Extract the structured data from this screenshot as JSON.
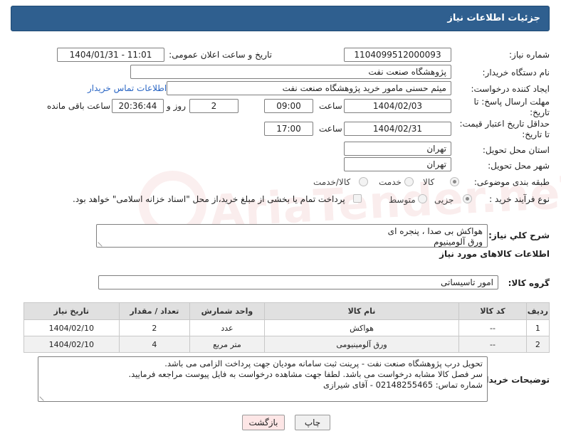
{
  "header": {
    "title": "جزئیات اطلاعات نیاز"
  },
  "form": {
    "need_number": {
      "label": "شماره نیاز:",
      "value": "1104099512000093"
    },
    "announce_datetime": {
      "label": "تاریخ و ساعت اعلان عمومی:",
      "value": "1404/01/31 - 11:01"
    },
    "buyer_org": {
      "label": "نام دستگاه خریدار:",
      "value": "پژوهشگاه صنعت نفت"
    },
    "requester": {
      "label": "ایجاد کننده درخواست:",
      "value": "میثم حسنی مامور خرید پژوهشگاه صنعت نفت",
      "contact_link": "اطلاعات تماس خریدار"
    },
    "reply_deadline": {
      "label_line1": "مهلت ارسال پاسخ: تا",
      "label_line2": "تاریخ:",
      "date": "1404/02/03",
      "time_label": "ساعت",
      "time": "09:00",
      "days": "2",
      "days_label": "روز و",
      "remaining": "20:36:44",
      "remaining_label": "ساعت باقی مانده"
    },
    "price_validity": {
      "label_line1": "حداقل تاریخ اعتبار قیمت:",
      "label_line2": "تا تاریخ:",
      "date": "1404/02/31",
      "time_label": "ساعت",
      "time": "17:00"
    },
    "province": {
      "label": "استان محل تحویل:",
      "value": "تهران"
    },
    "city": {
      "label": "شهر محل تحویل:",
      "value": "تهران"
    },
    "category": {
      "label": "طبقه بندی موضوعی:",
      "options": [
        "کالا",
        "خدمت",
        "کالا/خدمت"
      ],
      "selected": "کالا"
    },
    "purchase_type": {
      "label": "نوع فرآیند خرید :",
      "options": [
        "جزیی",
        "متوسط"
      ],
      "selected": "جزیی",
      "note": "پرداخت تمام یا بخشی از مبلغ خرید،از محل \"اسناد خزانه اسلامی\" خواهد بود."
    }
  },
  "watermark": {
    "text": "AriaTender.neT"
  },
  "general_description": {
    "label": "شرح کلي نياز:",
    "lines": [
      "هواکش بی صدا ، پنجره ای",
      "ورق آلومینیوم"
    ]
  },
  "items_section": {
    "title": "اطلاعات کالاهای مورد نیاز"
  },
  "goods_group": {
    "label": "گروه کالا:",
    "value": "امور تاسیساتی"
  },
  "table": {
    "headers": [
      "ردیف",
      "کد کالا",
      "نام کالا",
      "واحد شمارش",
      "تعداد / مقدار",
      "تاریخ نیاز"
    ],
    "rows": [
      [
        "1",
        "--",
        "هواکش",
        "عدد",
        "2",
        "1404/02/10"
      ],
      [
        "2",
        "--",
        "ورق آلومینیومی",
        "متر مربع",
        "4",
        "1404/02/10"
      ]
    ]
  },
  "buyer_notes": {
    "label": "توضیحات خریدار:",
    "lines": [
      "تحویل درب پژوهشگاه صنعت نفت - پرینت ثبت سامانه مودیان جهت پرداخت الزامی می باشد.",
      "سر فصل کالا مشابه درخواست می باشد. لطفا جهت مشاهده درخواست به فایل پیوست مراجعه فرمایید.",
      "شماره تماس: 02148255465 - آقای شیرازی"
    ]
  },
  "buttons": {
    "print": "چاپ",
    "back": "بازگشت"
  }
}
